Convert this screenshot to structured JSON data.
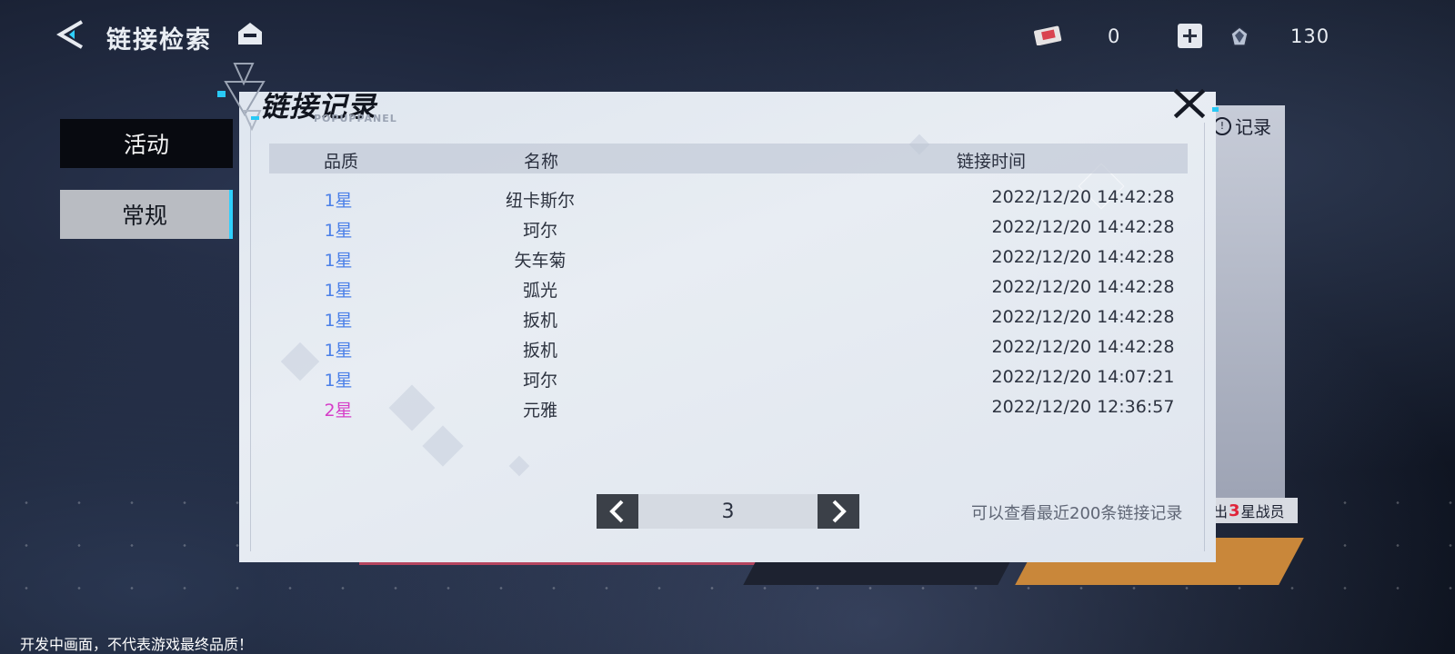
{
  "header": {
    "title": "链接检索",
    "back_icon": "back-arrow-icon",
    "home_icon": "home-icon",
    "currency_a_value": "0",
    "currency_b_value": "130"
  },
  "tabs": [
    {
      "label": "活动"
    },
    {
      "label": "常规"
    }
  ],
  "background_panel": {
    "record_label": "记录",
    "tag_prefix": "出",
    "tag_number": "3",
    "tag_suffix": "星战员"
  },
  "dialog": {
    "title": "链接记录",
    "subtitle": "POPUPPANEL",
    "columns": {
      "quality": "品质",
      "name": "名称",
      "time": "链接时间"
    },
    "rows": [
      {
        "quality": "1星",
        "name": "纽卡斯尔",
        "time": "2022/12/20 14:42:28",
        "color": "#4a7fe8"
      },
      {
        "quality": "1星",
        "name": "珂尔",
        "time": "2022/12/20 14:42:28",
        "color": "#4a7fe8"
      },
      {
        "quality": "1星",
        "name": "矢车菊",
        "time": "2022/12/20 14:42:28",
        "color": "#4a7fe8"
      },
      {
        "quality": "1星",
        "name": "弧光",
        "time": "2022/12/20 14:42:28",
        "color": "#4a7fe8"
      },
      {
        "quality": "1星",
        "name": "扳机",
        "time": "2022/12/20 14:42:28",
        "color": "#4a7fe8"
      },
      {
        "quality": "1星",
        "name": "扳机",
        "time": "2022/12/20 14:42:28",
        "color": "#4a7fe8"
      },
      {
        "quality": "1星",
        "name": "珂尔",
        "time": "2022/12/20 14:07:21",
        "color": "#4a7fe8"
      },
      {
        "quality": "2星",
        "name": "元雅",
        "time": "2022/12/20 12:36:57",
        "color": "#d63ec8"
      }
    ],
    "page": "3",
    "note": "可以查看最近200条链接记录"
  },
  "footer": {
    "note": "开发中画面，不代表游戏最终品质！"
  },
  "colors": {
    "accent_cyan": "#29c9f5",
    "quality_1": "#4a7fe8",
    "quality_2": "#d63ec8"
  }
}
